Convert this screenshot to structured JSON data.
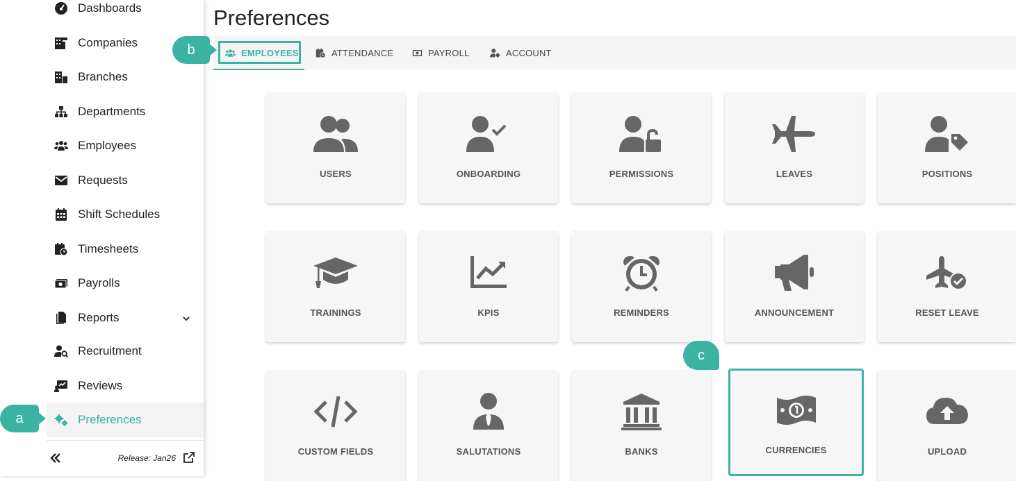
{
  "sidebar": {
    "items": [
      {
        "label": "Dashboards",
        "icon": "gauge-icon"
      },
      {
        "label": "Companies",
        "icon": "building-icon"
      },
      {
        "label": "Branches",
        "icon": "branches-icon"
      },
      {
        "label": "Departments",
        "icon": "sitemap-icon"
      },
      {
        "label": "Employees",
        "icon": "users-icon"
      },
      {
        "label": "Requests",
        "icon": "envelope-icon"
      },
      {
        "label": "Shift Schedules",
        "icon": "calendar-icon"
      },
      {
        "label": "Timesheets",
        "icon": "calendar-clock-icon"
      },
      {
        "label": "Payrolls",
        "icon": "money-icon"
      },
      {
        "label": "Reports",
        "icon": "file-icon"
      },
      {
        "label": "Recruitment",
        "icon": "user-search-icon"
      },
      {
        "label": "Reviews",
        "icon": "chart-board-icon"
      },
      {
        "label": "Preferences",
        "icon": "cogs-icon"
      }
    ],
    "active": "Preferences",
    "release": "Release: Jan26"
  },
  "callouts": {
    "a": "a",
    "b": "b",
    "c": "c"
  },
  "page": {
    "title": "Preferences"
  },
  "tabs": [
    {
      "label": "EMPLOYEES",
      "icon": "users-icon",
      "active": true
    },
    {
      "label": "ATTENDANCE",
      "icon": "calendar-clock-icon",
      "active": false
    },
    {
      "label": "PAYROLL",
      "icon": "money-icon",
      "active": false
    },
    {
      "label": "ACCOUNT",
      "icon": "user-cog-icon",
      "active": false
    }
  ],
  "cards": [
    {
      "label": "USERS",
      "icon": "users-icon"
    },
    {
      "label": "ONBOARDING",
      "icon": "user-check-icon"
    },
    {
      "label": "PERMISSIONS",
      "icon": "user-lock-icon"
    },
    {
      "label": "LEAVES",
      "icon": "plane-icon"
    },
    {
      "label": "POSITIONS",
      "icon": "user-tag-icon"
    },
    {
      "label": "TRAININGS",
      "icon": "graduation-cap-icon"
    },
    {
      "label": "KPIS",
      "icon": "chart-line-icon"
    },
    {
      "label": "REMINDERS",
      "icon": "alarm-clock-icon"
    },
    {
      "label": "ANNOUNCEMENT",
      "icon": "bullhorn-icon"
    },
    {
      "label": "RESET LEAVE",
      "icon": "plane-check-icon"
    },
    {
      "label": "CUSTOM FIELDS",
      "icon": "code-icon"
    },
    {
      "label": "SALUTATIONS",
      "icon": "user-tie-icon"
    },
    {
      "label": "BANKS",
      "icon": "bank-icon"
    },
    {
      "label": "CURRENCIES",
      "icon": "money-bill-icon"
    },
    {
      "label": "UPLOAD",
      "icon": "cloud-upload-icon"
    }
  ],
  "colors": {
    "accent": "#3bb3a3",
    "icon": "#666666",
    "card": "#f6f6f6"
  }
}
